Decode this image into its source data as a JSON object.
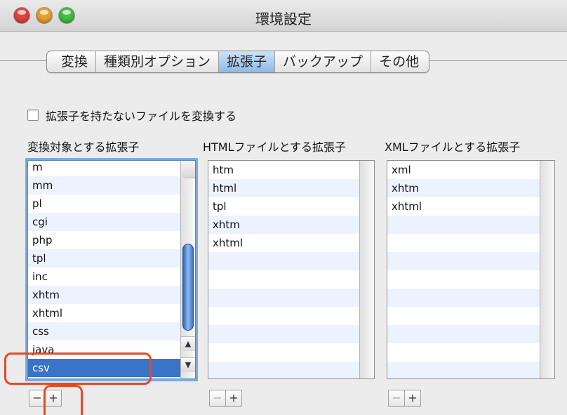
{
  "window": {
    "title": "環境設定",
    "traffic_lights": [
      {
        "name": "close",
        "color": "#e0443e"
      },
      {
        "name": "minimize",
        "color": "#e8a12a"
      },
      {
        "name": "zoom",
        "color": "#3fbf3c"
      }
    ]
  },
  "tabs": [
    {
      "label": "変換",
      "selected": false
    },
    {
      "label": "種類別オプション",
      "selected": false
    },
    {
      "label": "拡張子",
      "selected": true
    },
    {
      "label": "バックアップ",
      "selected": false
    },
    {
      "label": "その他",
      "selected": false
    }
  ],
  "options": {
    "no_ext_label": "拡張子を持たないファイルを変換する",
    "no_ext_checked": false
  },
  "columns": {
    "convert": {
      "header": "変換対象とする拡張子",
      "items": [
        "m",
        "mm",
        "pl",
        "cgi",
        "php",
        "tpl",
        "inc",
        "xhtm",
        "xhtml",
        "css",
        "java",
        "csv"
      ],
      "selected": "csv",
      "scroll_arrows": [
        "▲",
        "▼"
      ]
    },
    "html": {
      "header": "HTMLファイルとする拡張子",
      "items": [
        "htm",
        "html",
        "tpl",
        "xhtm",
        "xhtml"
      ]
    },
    "xml": {
      "header": "XMLファイルとする拡張子",
      "items": [
        "xml",
        "xhtm",
        "xhtml"
      ]
    }
  },
  "buttons": {
    "minus": "−",
    "plus": "+"
  },
  "colors": {
    "selection": "#3874c8",
    "alt_row": "#edf3fe",
    "annotation": "#e44a25"
  }
}
